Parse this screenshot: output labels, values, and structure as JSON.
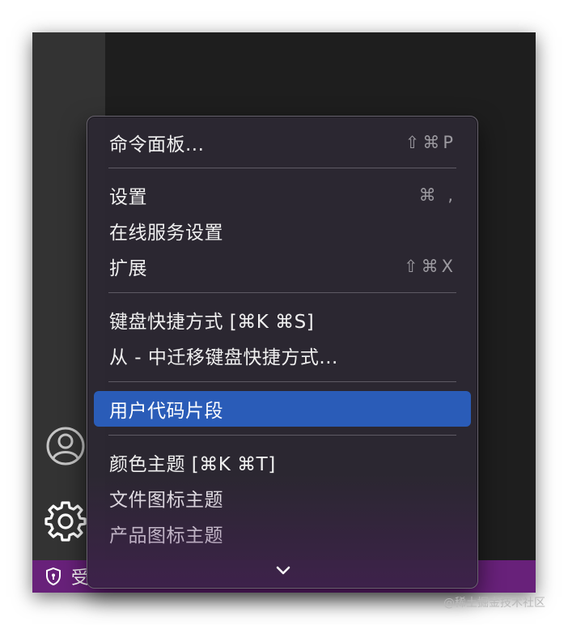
{
  "menu": {
    "command_palette": {
      "label": "命令面板...",
      "shortcut": "⇧⌘P"
    },
    "settings": {
      "label": "设置",
      "shortcut": "⌘ ,"
    },
    "online_settings": {
      "label": "在线服务设置"
    },
    "extensions": {
      "label": "扩展",
      "shortcut": "⇧⌘X"
    },
    "keyboard_shortcuts": {
      "label": "键盘快捷方式 [⌘K ⌘S]"
    },
    "migrate_shortcuts": {
      "label": "从 - 中迁移键盘快捷方式..."
    },
    "user_snippets": {
      "label": "用户代码片段"
    },
    "color_theme": {
      "label": "颜色主题 [⌘K ⌘T]"
    },
    "file_icon_theme": {
      "label": "文件图标主题"
    },
    "product_icon_theme": {
      "label": "产品图标主题"
    },
    "more_icon": "chevron-down-icon"
  },
  "activity_bar": {
    "accounts_icon": "account-icon",
    "manage_icon": "gear-icon"
  },
  "status_bar": {
    "item_label": "受",
    "item_icon": "shield-icon"
  },
  "watermark": "@稀土掘金技术社区",
  "colors": {
    "selection": "#2a5cb8",
    "status_bar": "#68217a",
    "activity_bar": "#333333",
    "editor": "#1e1e1e"
  }
}
